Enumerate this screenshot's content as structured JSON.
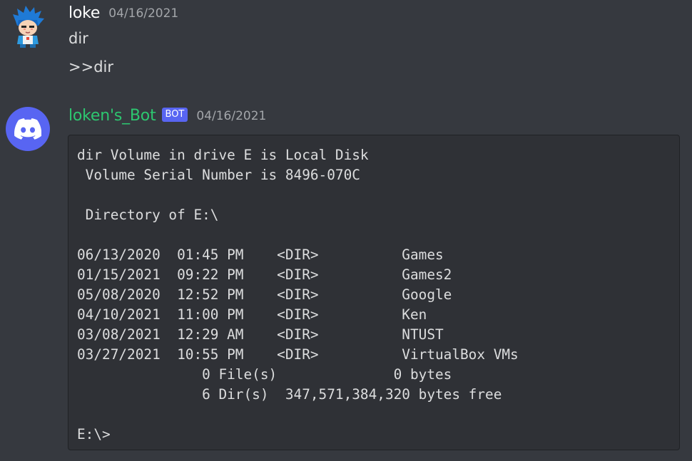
{
  "messages": [
    {
      "author": "loke",
      "timestamp": "04/16/2021",
      "lines": [
        "dir",
        ">>dir"
      ]
    },
    {
      "author": "loken's_Bot",
      "badge": "BOT",
      "timestamp": "04/16/2021",
      "code": "dir Volume in drive E is Local Disk\n Volume Serial Number is 8496-070C\n\n Directory of E:\\\n\n06/13/2020  01:45 PM    <DIR>          Games\n01/15/2021  09:22 PM    <DIR>          Games2\n05/08/2020  12:52 PM    <DIR>          Google\n04/10/2021  11:00 PM    <DIR>          Ken\n03/08/2021  12:29 AM    <DIR>          NTUST\n03/27/2021  10:55 PM    <DIR>          VirtualBox VMs\n               0 File(s)              0 bytes\n               6 Dir(s)  347,571,384,320 bytes free\n\nE:\\>"
    }
  ],
  "colors": {
    "background": "#36393f",
    "code_background": "#2f3136",
    "bot_name": "#2dc770",
    "bot_badge": "#5865f2",
    "timestamp": "#a3a6aa"
  },
  "icons": {
    "user_avatar": "anime-character-avatar",
    "bot_avatar": "discord-logo-icon"
  }
}
